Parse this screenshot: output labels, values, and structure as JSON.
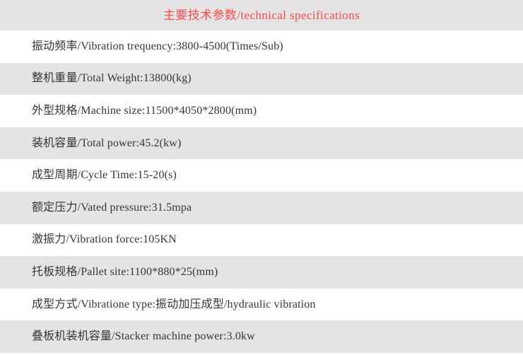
{
  "header": {
    "title": "主要技术参数/technical specifications",
    "title_color": "#fa4b4b",
    "background_color": "#e5e3e3"
  },
  "table": {
    "row_background_odd": "#ffffff",
    "row_background_even": "#e5e3e3",
    "text_color": "#363636",
    "rows": [
      {
        "text": "振动频率/Vibration trequency:3800-4500(Times/Sub)"
      },
      {
        "text": "整机重量/Total Weight:13800(kg)"
      },
      {
        "text": "外型规格/Machine size:11500*4050*2800(mm)"
      },
      {
        "text": "装机容量/Total power:45.2(kw)"
      },
      {
        "text": "成型周期/Cycle Time:15-20(s)"
      },
      {
        "text": "额定压力/Vated pressure:31.5mpa"
      },
      {
        "text": "激振力/Vibration force:105KN"
      },
      {
        "text": "托板规格/Pallet site:1100*880*25(mm)"
      },
      {
        "text": "成型方式/Vibratione type:振动加压成型/hydraulic vibration"
      },
      {
        "text": "叠板机装机容量/Stacker machine power:3.0kw"
      }
    ]
  }
}
